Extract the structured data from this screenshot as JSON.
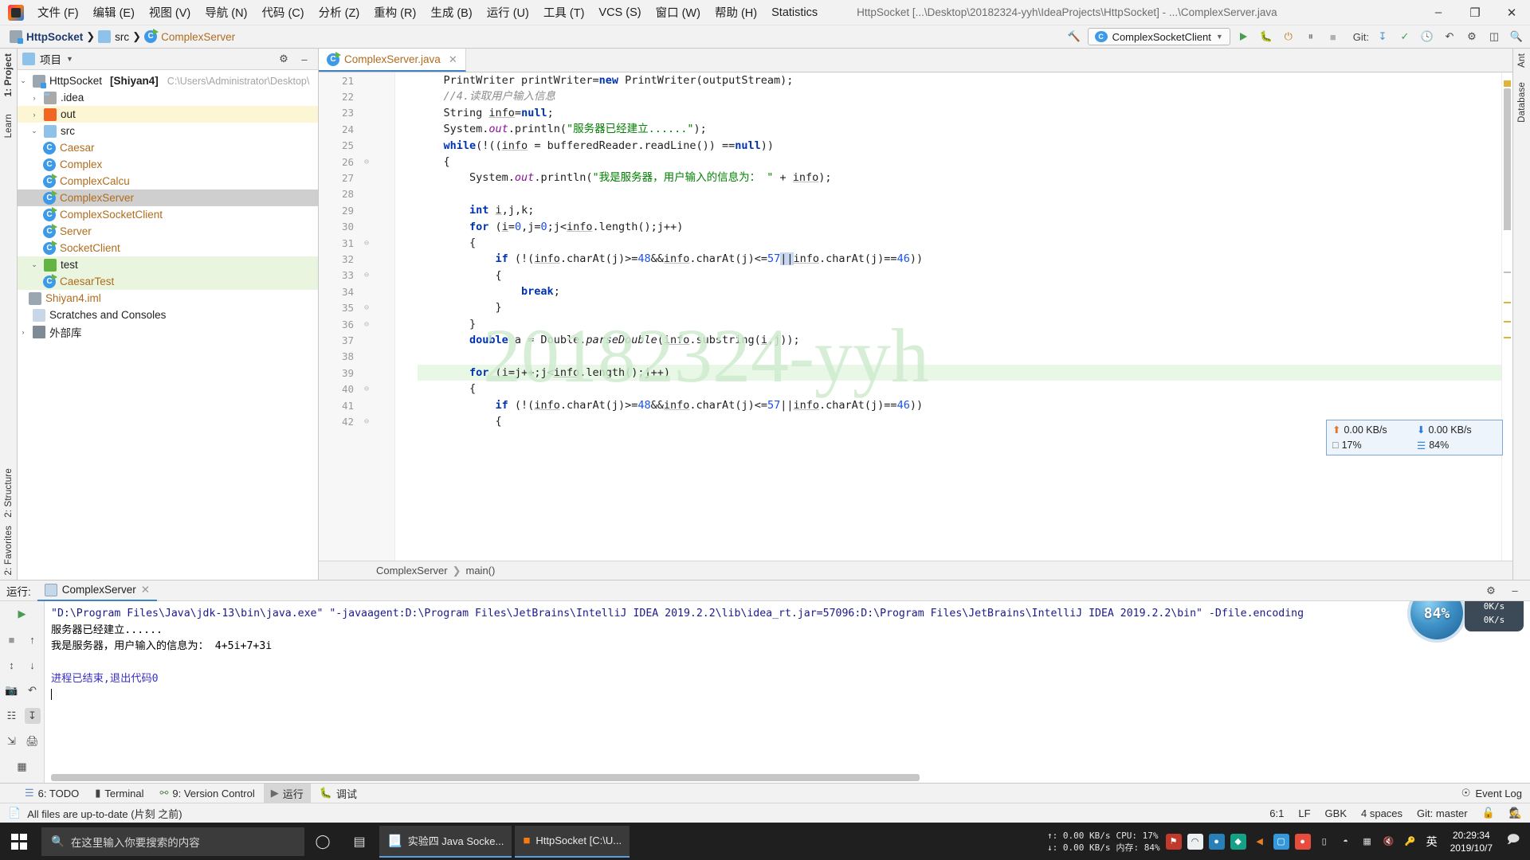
{
  "window": {
    "title": "HttpSocket [...\\Desktop\\20182324-yyh\\IdeaProjects\\HttpSocket] - ...\\ComplexServer.java",
    "minimize": "–",
    "maximize": "❐",
    "close": "✕"
  },
  "menu": [
    {
      "label": "文件 (F)"
    },
    {
      "label": "编辑 (E)"
    },
    {
      "label": "视图 (V)"
    },
    {
      "label": "导航 (N)"
    },
    {
      "label": "代码 (C)"
    },
    {
      "label": "分析 (Z)"
    },
    {
      "label": "重构 (R)"
    },
    {
      "label": "生成 (B)"
    },
    {
      "label": "运行 (U)"
    },
    {
      "label": "工具 (T)"
    },
    {
      "label": "VCS (S)"
    },
    {
      "label": "窗口 (W)"
    },
    {
      "label": "帮助 (H)"
    },
    {
      "label": "Statistics"
    }
  ],
  "navbar": {
    "crumbs": [
      "HttpSocket",
      "src",
      "ComplexServer"
    ],
    "run_config": "ComplexSocketClient",
    "git_label": "Git:",
    "search_icon": "search-icon"
  },
  "project_panel": {
    "title": "项目",
    "tree": [
      {
        "label": "HttpSocket",
        "module": "[Shiyan4]",
        "path": "C:\\Users\\Administrator\\Desktop\\",
        "indent": 0,
        "icon": "project-icon",
        "arrow": "⌄",
        "state": "normal"
      },
      {
        "label": ".idea",
        "indent": 1,
        "icon": "folder-icon",
        "arrow": "›",
        "state": "normal"
      },
      {
        "label": "out",
        "indent": 1,
        "icon": "folder-orange-icon",
        "arrow": "›",
        "state": "yellow"
      },
      {
        "label": "src",
        "indent": 1,
        "icon": "folder-icon",
        "arrow": "⌄",
        "state": "normal"
      },
      {
        "label": "Caesar",
        "indent": 2,
        "icon": "class-icon",
        "arrow": "",
        "state": "normal"
      },
      {
        "label": "Complex",
        "indent": 2,
        "icon": "class-icon",
        "arrow": "",
        "state": "normal"
      },
      {
        "label": "ComplexCalcu",
        "indent": 2,
        "icon": "runnable-class-icon",
        "arrow": "",
        "state": "normal"
      },
      {
        "label": "ComplexServer",
        "indent": 2,
        "icon": "runnable-class-icon",
        "arrow": "",
        "state": "selected"
      },
      {
        "label": "ComplexSocketClient",
        "indent": 2,
        "icon": "runnable-class-icon",
        "arrow": "",
        "state": "normal"
      },
      {
        "label": "Server",
        "indent": 2,
        "icon": "runnable-class-icon",
        "arrow": "",
        "state": "normal"
      },
      {
        "label": "SocketClient",
        "indent": 2,
        "icon": "runnable-class-icon",
        "arrow": "",
        "state": "normal"
      },
      {
        "label": "test",
        "indent": 1,
        "icon": "folder-green-icon",
        "arrow": "⌄",
        "state": "green"
      },
      {
        "label": "CaesarTest",
        "indent": 2,
        "icon": "runnable-class-icon",
        "arrow": "",
        "state": "green"
      },
      {
        "label": "Shiyan4.iml",
        "indent": 1,
        "icon": "module-icon",
        "arrow": "",
        "state": "normal"
      },
      {
        "label": "Scratches and Consoles",
        "indent": 0,
        "icon": "scratch-icon",
        "arrow": "",
        "state": "normal"
      },
      {
        "label": "外部库",
        "indent": 0,
        "icon": "library-icon",
        "arrow": "›",
        "state": "normal"
      }
    ]
  },
  "left_strip": {
    "tabs": [
      "1: Project",
      "Learn"
    ],
    "bottom": [
      "2: Structure",
      "2: Favorites"
    ]
  },
  "right_strip": {
    "tabs": [
      "Ant",
      "Database"
    ]
  },
  "editor": {
    "tab_name": "ComplexServer.java",
    "tab_close": "✕",
    "watermark": "20182324-yyh",
    "breadcrumb": [
      "ComplexServer",
      "main()"
    ],
    "first_line_number": 21,
    "lines": [
      {
        "n": 21,
        "fold": "",
        "text": "    PrintWriter printWriter=new PrintWriter(outputStream);"
      },
      {
        "n": 22,
        "fold": "",
        "text": "    //4.读取用户输入信息"
      },
      {
        "n": 23,
        "fold": "",
        "text": "    String info=null;"
      },
      {
        "n": 24,
        "fold": "",
        "text": "    System.out.println(\"服务器已经建立......\");"
      },
      {
        "n": 25,
        "fold": "",
        "text": "    while(!((info = bufferedReader.readLine()) ==null))"
      },
      {
        "n": 26,
        "fold": "⊖",
        "text": "    {"
      },
      {
        "n": 27,
        "fold": "",
        "text": "        System.out.println(\"我是服务器，用户输入的信息为： \" + info);"
      },
      {
        "n": 28,
        "fold": "",
        "text": ""
      },
      {
        "n": 29,
        "fold": "",
        "text": "        int i,j,k;"
      },
      {
        "n": 30,
        "fold": "",
        "text": "        for (i=0,j=0;j<info.length();j++)"
      },
      {
        "n": 31,
        "fold": "⊖",
        "text": "        {"
      },
      {
        "n": 32,
        "fold": "",
        "text": "            if (!(info.charAt(j)>=48&&info.charAt(j)<=57||info.charAt(j)==46))"
      },
      {
        "n": 33,
        "fold": "⊖",
        "text": "            {"
      },
      {
        "n": 34,
        "fold": "",
        "text": "                break;"
      },
      {
        "n": 35,
        "fold": "⊖",
        "text": "            }"
      },
      {
        "n": 36,
        "fold": "⊖",
        "text": "        }"
      },
      {
        "n": 37,
        "fold": "",
        "text": "        double a = Double.parseDouble(info.substring(i,j));"
      },
      {
        "n": 38,
        "fold": "",
        "text": ""
      },
      {
        "n": 39,
        "fold": "",
        "text": "        for (i=j++;j<info.length();j++)"
      },
      {
        "n": 40,
        "fold": "⊖",
        "text": "        {"
      },
      {
        "n": 41,
        "fold": "",
        "text": "            if (!(info.charAt(j)>=48&&info.charAt(j)<=57||info.charAt(j)==46))"
      },
      {
        "n": 42,
        "fold": "⊖",
        "text": "            {"
      }
    ]
  },
  "net_widget": {
    "up_speed": "0.00 KB/s",
    "down_speed": "0.00 KB/s",
    "cpu": "17%",
    "mem": "84%",
    "up_icon": "upload-arrow-icon",
    "down_icon": "download-arrow-icon",
    "cpu_icon": "cpu-icon",
    "mem_icon": "memory-icon"
  },
  "run_panel": {
    "title": "运行:",
    "tab": "ComplexServer",
    "tab_close": "✕",
    "console": [
      {
        "text": "\"D:\\Program Files\\Java\\jdk-13\\bin\\java.exe\" \"-javaagent:D:\\Program Files\\JetBrains\\IntelliJ IDEA 2019.2.2\\lib\\idea_rt.jar=57096:D:\\Program Files\\JetBrains\\IntelliJ IDEA 2019.2.2\\bin\" -Dfile.encoding",
        "kind": "cmd"
      },
      {
        "text": "服务器已经建立......",
        "kind": "out"
      },
      {
        "text": "我是服务器，用户输入的信息为： 4+5i+7+3i",
        "kind": "out"
      },
      {
        "text": "",
        "kind": "out"
      },
      {
        "text": "进程已结束,退出代码0",
        "kind": "exit"
      },
      {
        "text": "",
        "kind": "caret"
      }
    ],
    "overlay": {
      "earth_label": "84%",
      "up_rate": "0K/s",
      "down_rate": "0K/s"
    }
  },
  "bottom_tabs": [
    {
      "label": "6: TODO",
      "icon": "todo-icon",
      "active": false
    },
    {
      "label": "Terminal",
      "icon": "terminal-icon",
      "active": false
    },
    {
      "label": "9: Version Control",
      "icon": "branch-icon",
      "active": false
    },
    {
      "label": "运行",
      "icon": "run-icon",
      "active": true
    },
    {
      "label": "调试",
      "icon": "debug-icon",
      "active": false
    }
  ],
  "bottom_tabs_right": {
    "event_log": "Event Log",
    "event_log_icon": "bell-icon"
  },
  "statusbar": {
    "message": "All files are up-to-date (片刻 之前)",
    "message_icon": "file-icon",
    "caret": "6:1",
    "line_sep": "LF",
    "encoding": "GBK",
    "indent": "4 spaces",
    "git": "Git: master",
    "lock_icon": "unlock-icon",
    "inspector_icon": "inspector-icon"
  },
  "taskbar": {
    "search_placeholder": "在这里输入你要搜索的内容",
    "search_icon": "search-icon",
    "cortana_icon": "cortana-icon",
    "taskview_icon": "task-view-icon",
    "apps": [
      {
        "label": "实验四 Java Socke...",
        "icon": "word-icon"
      },
      {
        "label": "HttpSocket [C:\\U...",
        "icon": "idea-icon"
      }
    ],
    "tray": {
      "up_rate": "↑:  0.00 KB/s",
      "down_rate": "↓:  0.00 KB/s",
      "cpu": "CPU:  17%",
      "mem": "内存: 84%",
      "ime": "英",
      "time": "20:29:34",
      "date": "2019/10/7",
      "icons": [
        "security-icon",
        "monitor-icon",
        "edge-icon",
        "shield-icon",
        "volume-icon",
        "phone-icon",
        "qq-icon",
        "display-icon",
        "wifi-icon",
        "network-icon",
        "mute-icon",
        "key-icon"
      ]
    }
  },
  "colors": {
    "accent": "#4083c9",
    "keyword": "#0033b3",
    "string": "#008000",
    "comment": "#8c8c8c",
    "number": "#1750eb",
    "watermark": "#cfeccf",
    "selected_row": "#cfcfcf"
  }
}
